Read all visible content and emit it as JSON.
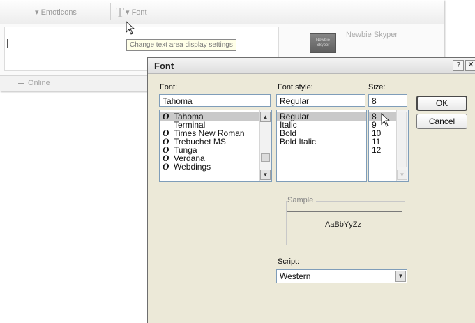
{
  "chat": {
    "toolbar": {
      "emoticons_label": "Emoticons",
      "font_label": "Font",
      "font_glyph": "T"
    },
    "tooltip": "Change text area display settings",
    "contact_name": "Newbie Skyper",
    "avatar_text": "Newbie Skyper",
    "status": "Online"
  },
  "dialog": {
    "title": "Font",
    "help_glyph": "?",
    "close_glyph": "✕",
    "font": {
      "label": "Font:",
      "value": "Tahoma",
      "items": [
        {
          "name": "Tahoma",
          "tt": true
        },
        {
          "name": "Terminal",
          "tt": false
        },
        {
          "name": "Times New Roman",
          "tt": true
        },
        {
          "name": "Trebuchet MS",
          "tt": true
        },
        {
          "name": "Tunga",
          "tt": true
        },
        {
          "name": "Verdana",
          "tt": true
        },
        {
          "name": "Webdings",
          "tt": true
        }
      ],
      "selected": "Tahoma"
    },
    "style": {
      "label": "Font style:",
      "value": "Regular",
      "items": [
        "Regular",
        "Italic",
        "Bold",
        "Bold Italic"
      ],
      "selected": "Regular"
    },
    "size": {
      "label": "Size:",
      "value": "8",
      "items": [
        "8",
        "9",
        "10",
        "11",
        "12"
      ],
      "selected": "8"
    },
    "ok_label": "OK",
    "cancel_label": "Cancel",
    "sample": {
      "label": "Sample",
      "text": "AaBbYyZz"
    },
    "script": {
      "label": "Script:",
      "value": "Western"
    }
  },
  "tt_glyph": "O",
  "icons": {
    "scroll_up": "▲",
    "scroll_down": "▼",
    "combo_arrow": "▼"
  }
}
